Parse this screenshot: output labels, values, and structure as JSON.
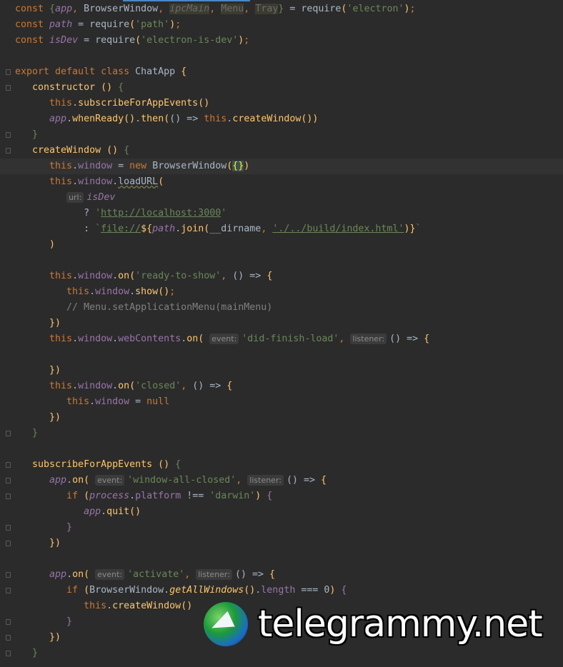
{
  "editor": {
    "lines": [
      {
        "fold": false,
        "tokens": [
          [
            "const ",
            "k"
          ],
          [
            "{",
            "gr"
          ],
          [
            "app",
            "fi"
          ],
          [
            ", ",
            "k"
          ],
          [
            "BrowserWindow",
            "d"
          ],
          [
            ", ",
            "k"
          ],
          [
            "ipcMain",
            "dim"
          ],
          [
            ", ",
            "k"
          ],
          [
            "Menu",
            "dimn"
          ],
          [
            ", ",
            "k"
          ],
          [
            "Tray",
            "dimn"
          ],
          [
            "}",
            "gr"
          ],
          [
            " = require",
            "d"
          ],
          [
            "(",
            "fn"
          ],
          [
            "'electron'",
            "s"
          ],
          [
            ")",
            "fn"
          ],
          [
            ";",
            "k"
          ]
        ]
      },
      {
        "tokens": [
          [
            "const ",
            "k"
          ],
          [
            "path",
            "fi"
          ],
          [
            " = require",
            "d"
          ],
          [
            "(",
            "fn"
          ],
          [
            "'path'",
            "s"
          ],
          [
            ")",
            "fn"
          ],
          [
            ";",
            "k"
          ]
        ]
      },
      {
        "tokens": [
          [
            "const ",
            "k"
          ],
          [
            "isDev",
            "fi"
          ],
          [
            " = require",
            "d"
          ],
          [
            "(",
            "fn"
          ],
          [
            "'electron-is-dev'",
            "s"
          ],
          [
            ")",
            "fn"
          ],
          [
            ";",
            "k"
          ]
        ]
      },
      {
        "tokens": []
      },
      {
        "fold": true,
        "tokens": [
          [
            "export default class ",
            "k"
          ],
          [
            "ChatApp ",
            "d"
          ],
          [
            "{",
            "fn"
          ]
        ]
      },
      {
        "fold": true,
        "tokens": [
          [
            "   constructor ",
            "fn"
          ],
          [
            "() ",
            "fn"
          ],
          [
            "{",
            "gr"
          ]
        ]
      },
      {
        "tokens": [
          [
            "      this",
            "k"
          ],
          [
            ".",
            "d"
          ],
          [
            "subscribeForAppEvents",
            "fn"
          ],
          [
            "()",
            "fn"
          ]
        ]
      },
      {
        "tokens": [
          [
            "      app",
            "fi"
          ],
          [
            ".",
            "d"
          ],
          [
            "whenReady",
            "fn"
          ],
          [
            "()",
            "fn"
          ],
          [
            ".",
            "d"
          ],
          [
            "then",
            "fn"
          ],
          [
            "(",
            "fn"
          ],
          [
            "() => ",
            "d"
          ],
          [
            "this",
            "k"
          ],
          [
            ".",
            "d"
          ],
          [
            "createWindow",
            "fn"
          ],
          [
            "())",
            "fn"
          ]
        ]
      },
      {
        "fold": true,
        "tokens": [
          [
            "   }",
            "gr"
          ]
        ]
      },
      {
        "fold": true,
        "tokens": [
          [
            "   createWindow ",
            "fn"
          ],
          [
            "() ",
            "fn"
          ],
          [
            "{",
            "gr"
          ]
        ]
      },
      {
        "cur": true,
        "tokens": [
          [
            "      this",
            "k"
          ],
          [
            ".",
            "d"
          ],
          [
            "window",
            "f"
          ],
          [
            " = ",
            "d"
          ],
          [
            "new ",
            "k"
          ],
          [
            "BrowserWindow",
            "d"
          ],
          [
            "(",
            "fn"
          ],
          [
            "{}",
            "br"
          ],
          [
            ")",
            "fn"
          ]
        ]
      },
      {
        "tokens": [
          [
            "      this",
            "k"
          ],
          [
            ".",
            "d"
          ],
          [
            "window",
            "f"
          ],
          [
            ".",
            "d"
          ],
          [
            "loadURL",
            "u"
          ],
          [
            "(",
            "fn"
          ]
        ]
      },
      {
        "tokens": [
          [
            "         ",
            "d"
          ],
          [
            "url:",
            "h"
          ],
          [
            "isDev",
            "fi"
          ]
        ]
      },
      {
        "tokens": [
          [
            "            ? ",
            "d"
          ],
          [
            "'",
            "s"
          ],
          [
            "http://localhost:3000",
            "su"
          ],
          [
            "'",
            "s"
          ]
        ]
      },
      {
        "tokens": [
          [
            "            : ",
            "d"
          ],
          [
            "`",
            "s"
          ],
          [
            "file://",
            "su"
          ],
          [
            "${",
            "fn"
          ],
          [
            "path",
            "fi"
          ],
          [
            ".",
            "d"
          ],
          [
            "join",
            "fn"
          ],
          [
            "(",
            "fn"
          ],
          [
            "__dirname",
            "d"
          ],
          [
            ", ",
            "k"
          ],
          [
            "'./../build/index.html'",
            "su"
          ],
          [
            ")",
            "fn"
          ],
          [
            "}",
            "fn"
          ],
          [
            "`",
            "s"
          ]
        ]
      },
      {
        "tokens": [
          [
            "      )",
            "fn"
          ]
        ]
      },
      {
        "tokens": []
      },
      {
        "tokens": [
          [
            "      this",
            "k"
          ],
          [
            ".",
            "d"
          ],
          [
            "window",
            "f"
          ],
          [
            ".",
            "d"
          ],
          [
            "on",
            "fn"
          ],
          [
            "(",
            "fn"
          ],
          [
            "'ready-to-show'",
            "s"
          ],
          [
            ", ",
            "k"
          ],
          [
            "() => ",
            "d"
          ],
          [
            "{",
            "fn"
          ]
        ]
      },
      {
        "tokens": [
          [
            "         this",
            "k"
          ],
          [
            ".",
            "d"
          ],
          [
            "window",
            "f"
          ],
          [
            ".",
            "d"
          ],
          [
            "show",
            "fn"
          ],
          [
            "()",
            "fn"
          ],
          [
            ";",
            "k"
          ]
        ]
      },
      {
        "tokens": [
          [
            "         // Menu.setApplicationMenu(mainMenu)",
            "c"
          ]
        ]
      },
      {
        "tokens": [
          [
            "      })",
            "fn"
          ]
        ]
      },
      {
        "tokens": [
          [
            "      this",
            "k"
          ],
          [
            ".",
            "d"
          ],
          [
            "window",
            "f"
          ],
          [
            ".",
            "d"
          ],
          [
            "webContents",
            "f"
          ],
          [
            ".",
            "d"
          ],
          [
            "on",
            "fn"
          ],
          [
            "( ",
            "fn"
          ],
          [
            "event:",
            "h"
          ],
          [
            "'did-finish-load'",
            "s"
          ],
          [
            ", ",
            "k"
          ],
          [
            "listener:",
            "h"
          ],
          [
            "() => ",
            "d"
          ],
          [
            "{",
            "fn"
          ]
        ]
      },
      {
        "tokens": []
      },
      {
        "tokens": [
          [
            "      })",
            "fn"
          ]
        ]
      },
      {
        "tokens": [
          [
            "      this",
            "k"
          ],
          [
            ".",
            "d"
          ],
          [
            "window",
            "f"
          ],
          [
            ".",
            "d"
          ],
          [
            "on",
            "fn"
          ],
          [
            "(",
            "fn"
          ],
          [
            "'closed'",
            "s"
          ],
          [
            ", ",
            "k"
          ],
          [
            "() => ",
            "d"
          ],
          [
            "{",
            "fn"
          ]
        ]
      },
      {
        "tokens": [
          [
            "         this",
            "k"
          ],
          [
            ".",
            "d"
          ],
          [
            "window",
            "f"
          ],
          [
            " = ",
            "d"
          ],
          [
            "null",
            "k"
          ]
        ]
      },
      {
        "tokens": [
          [
            "      })",
            "fn"
          ]
        ]
      },
      {
        "fold": true,
        "tokens": [
          [
            "   }",
            "gr"
          ]
        ]
      },
      {
        "tokens": []
      },
      {
        "fold": true,
        "tokens": [
          [
            "   subscribeForAppEvents ",
            "fn"
          ],
          [
            "() ",
            "fn"
          ],
          [
            "{",
            "gr"
          ]
        ]
      },
      {
        "fold": true,
        "tokens": [
          [
            "      app",
            "fi"
          ],
          [
            ".",
            "d"
          ],
          [
            "on",
            "fn"
          ],
          [
            "( ",
            "fn"
          ],
          [
            "event:",
            "h"
          ],
          [
            "'window-all-closed'",
            "s"
          ],
          [
            ", ",
            "k"
          ],
          [
            "listener:",
            "h"
          ],
          [
            "() => ",
            "d"
          ],
          [
            "{",
            "fn"
          ]
        ]
      },
      {
        "fold": true,
        "tokens": [
          [
            "         if ",
            "k"
          ],
          [
            "(",
            "fn"
          ],
          [
            "process",
            "fi"
          ],
          [
            ".",
            "d"
          ],
          [
            "platform",
            "f"
          ],
          [
            " !== ",
            "d"
          ],
          [
            "'darwin'",
            "s"
          ],
          [
            ") ",
            "fn"
          ],
          [
            "{",
            "f"
          ]
        ]
      },
      {
        "tokens": [
          [
            "            app",
            "fi"
          ],
          [
            ".",
            "d"
          ],
          [
            "quit",
            "fn"
          ],
          [
            "()",
            "fn"
          ]
        ]
      },
      {
        "fold": true,
        "tokens": [
          [
            "         }",
            "f"
          ]
        ]
      },
      {
        "fold": true,
        "tokens": [
          [
            "      })",
            "fn"
          ]
        ]
      },
      {
        "tokens": []
      },
      {
        "fold": true,
        "tokens": [
          [
            "      app",
            "fi"
          ],
          [
            ".",
            "d"
          ],
          [
            "on",
            "fn"
          ],
          [
            "( ",
            "fn"
          ],
          [
            "event:",
            "h"
          ],
          [
            "'activate'",
            "s"
          ],
          [
            ", ",
            "k"
          ],
          [
            "listener:",
            "h"
          ],
          [
            "() => ",
            "d"
          ],
          [
            "{",
            "fn"
          ]
        ]
      },
      {
        "fold": true,
        "tokens": [
          [
            "         if ",
            "k"
          ],
          [
            "(",
            "fn"
          ],
          [
            "BrowserWindow",
            "d"
          ],
          [
            ".",
            "d"
          ],
          [
            "getAllWindows",
            "fni"
          ],
          [
            "()",
            "fn"
          ],
          [
            ".",
            "d"
          ],
          [
            "length",
            "f"
          ],
          [
            " === ",
            "d"
          ],
          [
            "0",
            "d"
          ],
          [
            ") ",
            "fn"
          ],
          [
            "{",
            "f"
          ]
        ]
      },
      {
        "tokens": [
          [
            "            this",
            "k"
          ],
          [
            ".",
            "d"
          ],
          [
            "createWindow",
            "fn"
          ],
          [
            "()",
            "fn"
          ]
        ]
      },
      {
        "fold": true,
        "tokens": [
          [
            "         }",
            "f"
          ]
        ]
      },
      {
        "fold": true,
        "tokens": [
          [
            "      })",
            "fn"
          ]
        ]
      },
      {
        "fold": true,
        "tokens": [
          [
            "   }",
            "gr"
          ]
        ]
      }
    ]
  },
  "watermark": {
    "text": "telegrammy.net"
  },
  "colors": {
    "background": "#2b2b2b",
    "keyword": "#cc7832",
    "string": "#6a8759",
    "field": "#9876aa",
    "method": "#ffc66d"
  }
}
